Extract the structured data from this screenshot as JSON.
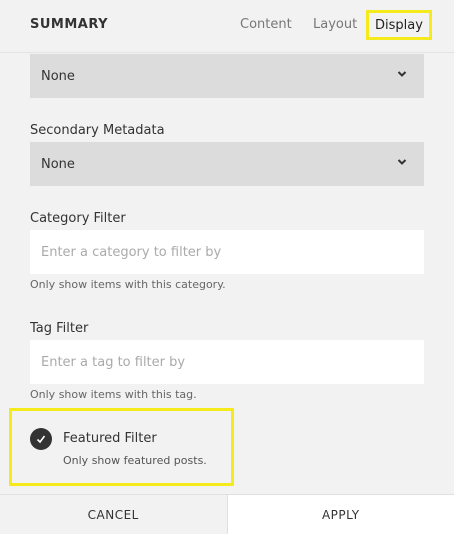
{
  "header": {
    "title": "SUMMARY",
    "tabs": [
      "Content",
      "Layout",
      "Display"
    ],
    "active_tab": "Display"
  },
  "fields": {
    "primary_metadata": {
      "value": "None"
    },
    "secondary_metadata": {
      "label": "Secondary Metadata",
      "value": "None"
    },
    "category_filter": {
      "label": "Category Filter",
      "placeholder": "Enter a category to filter by",
      "help": "Only show items with this category."
    },
    "tag_filter": {
      "label": "Tag Filter",
      "placeholder": "Enter a tag to filter by",
      "help": "Only show items with this tag."
    },
    "featured_filter": {
      "label": "Featured Filter",
      "help": "Only show featured posts.",
      "checked": true
    }
  },
  "footer": {
    "cancel_label": "CANCEL",
    "apply_label": "APPLY"
  },
  "colors": {
    "highlight": "#f5ea1c",
    "panel_bg": "#f2f2f2",
    "select_bg": "#dcdcdc"
  }
}
